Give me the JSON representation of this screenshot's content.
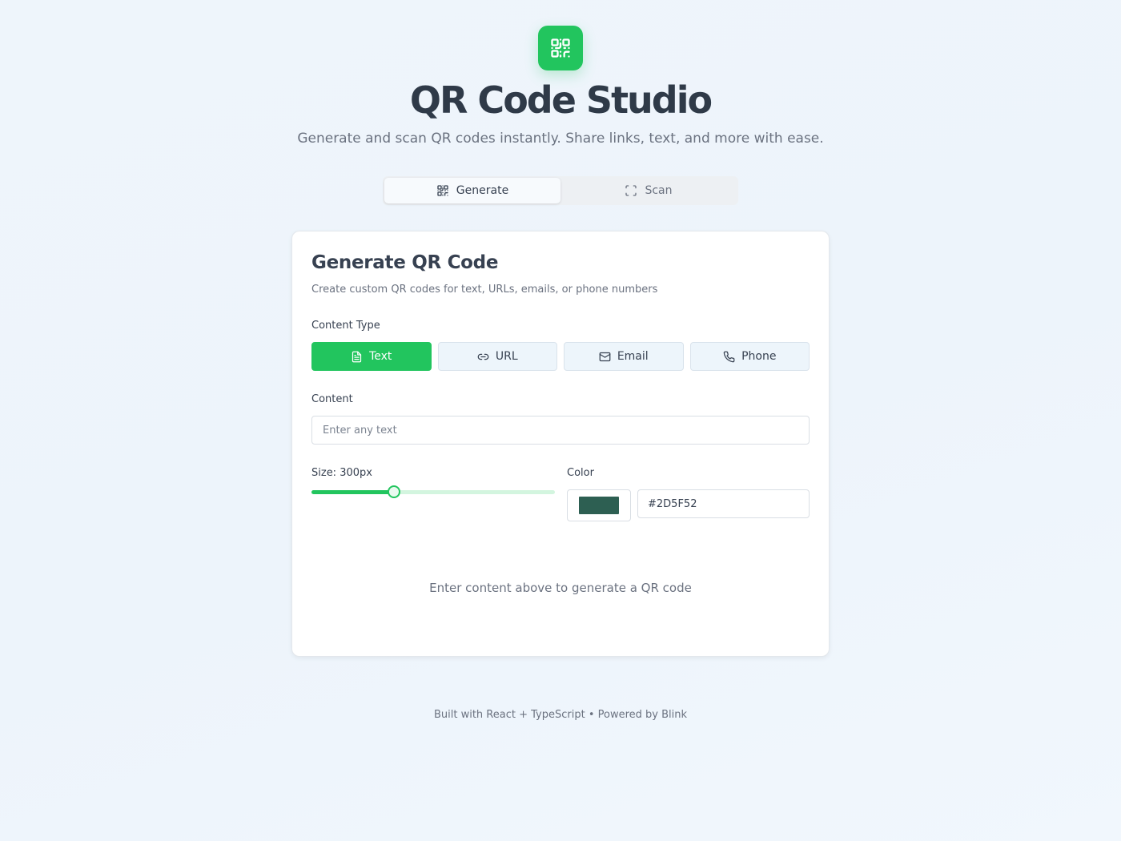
{
  "header": {
    "logo_icon": "qr-code-icon",
    "title": "QR Code Studio",
    "subtitle": "Generate and scan QR codes instantly. Share links, text, and more with ease."
  },
  "tabs": [
    {
      "label": "Generate",
      "icon": "qr-code-icon",
      "active": true
    },
    {
      "label": "Scan",
      "icon": "scan-frame-icon",
      "active": false
    }
  ],
  "card": {
    "title": "Generate QR Code",
    "description": "Create custom QR codes for text, URLs, emails, or phone numbers",
    "content_type_label": "Content Type",
    "content_types": [
      {
        "label": "Text",
        "icon": "file-text-icon",
        "active": true
      },
      {
        "label": "URL",
        "icon": "link-icon",
        "active": false
      },
      {
        "label": "Email",
        "icon": "mail-icon",
        "active": false
      },
      {
        "label": "Phone",
        "icon": "phone-icon",
        "active": false
      }
    ],
    "content_label": "Content",
    "content_value": "",
    "content_placeholder": "Enter any text",
    "size_label": "Size: 300px",
    "size_fraction": 0.34,
    "color_label": "Color",
    "color_value": "#2D5F52",
    "empty_message": "Enter content above to generate a QR code"
  },
  "footer": "Built with React + TypeScript • Powered by Blink",
  "colors": {
    "accent": "#22c55e",
    "qr_color": "#2D5F52"
  }
}
